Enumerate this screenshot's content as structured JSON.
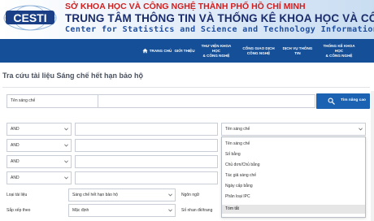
{
  "header": {
    "logo_text": "CESTI",
    "line1": "SỞ KHOA HỌC VÀ CÔNG NGHỆ THÀNH PHỐ HỒ CHÍ MINH",
    "line2": "TRUNG TÂM THÔNG TIN VÀ THỐNG KÊ KHOA HỌC VÀ CÔNG NGHỆ",
    "line3": "Center for Statistics and Science and Technology Information"
  },
  "nav": {
    "items": [
      {
        "label": "TRANG CHỦ",
        "icon": "home-icon"
      },
      {
        "label": "GIỚI THIỆU"
      },
      {
        "label": "THƯ VIỆN KHOA HỌC\n& CÔNG NGHỆ"
      },
      {
        "label": "CỔNG GIAO DỊCH\nCÔNG NGHỆ"
      },
      {
        "label": "DỊCH VỤ THÔNG TIN"
      },
      {
        "label": "THỐNG KÊ KHOA HỌC\n& CÔNG NGHỆ"
      }
    ]
  },
  "page": {
    "title": "Tra cứu tài liệu Sáng chế hết hạn bảo hộ"
  },
  "search": {
    "field_select": "Tên sáng chế",
    "query_value": "",
    "button_label": "Tìm nâng cao",
    "button_icon": "search-icon"
  },
  "criteria": {
    "rows": [
      {
        "operator": "AND",
        "field": "Tên sáng chế"
      },
      {
        "operator": "AND"
      },
      {
        "operator": "AND"
      },
      {
        "operator": "AND"
      }
    ]
  },
  "filters": {
    "doc_type_label": "Loại tài liệu",
    "doc_type_value": "Sáng chế hết hạn bảo hộ",
    "language_label": "Ngôn ngữ",
    "sort_label": "Sắp xếp theo",
    "sort_value": "Mặc định",
    "per_page_label": "Số nhan đề/trang"
  },
  "dropdown": {
    "options": [
      "Tên sáng chế",
      "Số bằng",
      "Chủ đơn/Chủ bằng",
      "Tác giả sáng chế",
      "Ngày cấp bằng",
      "Phân loại IPC",
      "Tóm tắt"
    ],
    "highlighted": "Tóm tắt"
  },
  "colors": {
    "nav_bg": "#144f97",
    "button_bg": "#1b62b3",
    "header_red": "#d11f1f",
    "header_navy": "#1a2c6b"
  }
}
